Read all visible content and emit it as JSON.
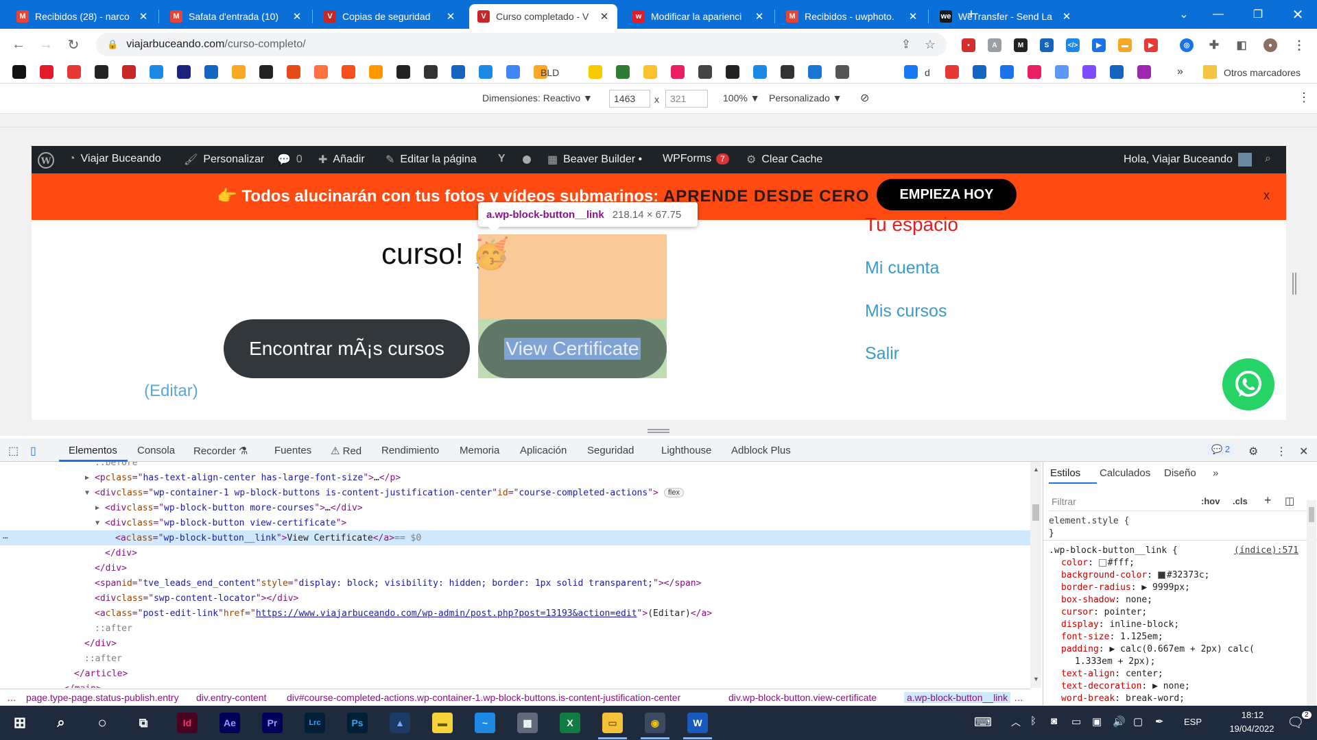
{
  "browser": {
    "tabs": [
      {
        "title": "Recibidos (28) - narco",
        "icon": "gmail-icon",
        "color": "#ea4335",
        "glyph": "M"
      },
      {
        "title": "Safata d'entrada (10)",
        "icon": "gmail-icon",
        "color": "#ea4335",
        "glyph": "M"
      },
      {
        "title": "Copias de seguridad",
        "icon": "site-icon",
        "color": "#c62828",
        "glyph": "V"
      },
      {
        "title": "Curso completado - V",
        "icon": "site-icon",
        "color": "#c62828",
        "glyph": "V"
      },
      {
        "title": "Modificar la aparienci",
        "icon": "wix-icon",
        "color": "#e21c2a",
        "glyph": "w"
      },
      {
        "title": "Recibidos - uwphoto.",
        "icon": "gmail-icon",
        "color": "#ea4335",
        "glyph": "M"
      },
      {
        "title": "WeTransfer - Send La",
        "icon": "wetransfer-icon",
        "color": "#17181a",
        "glyph": "we"
      }
    ],
    "active_tab": 3,
    "url_host": "viajarbuceando.com",
    "url_path": "/curso-completo/",
    "bookmarks_more": "»",
    "other_bookmarks": "Otros marcadores",
    "bookmark_bld": "BLD",
    "bookmark_d": "d"
  },
  "device_toolbar": {
    "dimensions_label": "Dimensiones: Reactivo ▼",
    "width": "1463",
    "times": "x",
    "height": "321",
    "zoom": "100% ▼",
    "throttle": "Personalizado ▼"
  },
  "adminbar": {
    "site": "Viajar Buceando",
    "customize": "Personalizar",
    "comments": "0",
    "add": "Añadir",
    "edit_page": "Editar la página",
    "beaver": "Beaver Builder •",
    "wpforms": "WPForms",
    "wpforms_count": "7",
    "clear_cache": "Clear Cache",
    "greeting": "Hola, Viajar Buceando"
  },
  "promo": {
    "text": "👉 Todos alucinarán con tus fotos y vídeos submarinos: ",
    "highlight": "APRENDE DESDE CERO",
    "button": "EMPIEZA HOY",
    "close": "x"
  },
  "content": {
    "heading": "curso! 🥳",
    "more_courses": "Encontrar mÃ¡s cursos",
    "view_certificate": "View Certificate",
    "edit": "(Editar)"
  },
  "inspector_tooltip": {
    "selector": "a.wp-block-button__link",
    "dims": "218.14 × 67.75"
  },
  "sidebar": {
    "title": "Tu espacio",
    "links": [
      "Mi cuenta",
      "Mis cursos",
      "Salir"
    ]
  },
  "devtools": {
    "tabs": [
      "Elementos",
      "Consola",
      "Recorder ⚗",
      "Fuentes",
      "⚠ Red",
      "Rendimiento",
      "Memoria",
      "Aplicación",
      "Seguridad",
      "Lighthouse",
      "Adblock Plus"
    ],
    "issues_count": "2",
    "elements": [
      {
        "indent": 0,
        "tri": "",
        "parts": [
          [
            "cm",
            "::before"
          ]
        ]
      },
      {
        "indent": 0,
        "tri": "▶",
        "parts": [
          [
            "tg",
            "<p "
          ],
          [
            "an",
            "class"
          ],
          [
            "tg",
            "=\""
          ],
          [
            "av",
            "has-text-align-center has-large-font-size"
          ],
          [
            "tg",
            "\">"
          ],
          [
            "",
            "…"
          ],
          [
            "tg",
            "</p>"
          ]
        ]
      },
      {
        "indent": 0,
        "tri": "▼",
        "parts": [
          [
            "tg",
            "<div "
          ],
          [
            "an",
            "class"
          ],
          [
            "tg",
            "=\""
          ],
          [
            "av",
            "wp-container-1 wp-block-buttons is-content-justification-center"
          ],
          [
            "tg",
            "\" "
          ],
          [
            "an",
            "id"
          ],
          [
            "tg",
            "=\""
          ],
          [
            "av",
            "course-completed-actions"
          ],
          [
            "tg",
            "\">"
          ]
        ],
        "badge": "flex"
      },
      {
        "indent": 1,
        "tri": "▶",
        "parts": [
          [
            "tg",
            "<div "
          ],
          [
            "an",
            "class"
          ],
          [
            "tg",
            "=\""
          ],
          [
            "av",
            "wp-block-button more-courses"
          ],
          [
            "tg",
            "\">"
          ],
          [
            "",
            "…"
          ],
          [
            "tg",
            "</div>"
          ]
        ]
      },
      {
        "indent": 1,
        "tri": "▼",
        "parts": [
          [
            "tg",
            "<div "
          ],
          [
            "an",
            "class"
          ],
          [
            "tg",
            "=\""
          ],
          [
            "av",
            "wp-block-button view-certificate"
          ],
          [
            "tg",
            "\">"
          ]
        ]
      },
      {
        "indent": 2,
        "tri": "",
        "sel": true,
        "parts": [
          [
            "tg",
            "<a "
          ],
          [
            "an",
            "class"
          ],
          [
            "tg",
            "=\""
          ],
          [
            "av",
            "wp-block-button__link"
          ],
          [
            "tg",
            "\">"
          ],
          [
            "",
            "View Certificate"
          ],
          [
            "tg",
            "</a>"
          ],
          [
            "cm",
            " == $0"
          ]
        ]
      },
      {
        "indent": 1,
        "tri": "",
        "parts": [
          [
            "tg",
            "</div>"
          ]
        ]
      },
      {
        "indent": 0,
        "tri": "",
        "parts": [
          [
            "tg",
            "</div>"
          ]
        ]
      },
      {
        "indent": 0,
        "tri": "",
        "parts": [
          [
            "tg",
            "<span "
          ],
          [
            "an",
            "id"
          ],
          [
            "tg",
            "=\""
          ],
          [
            "av",
            "tve_leads_end_content"
          ],
          [
            "tg",
            "\" "
          ],
          [
            "an",
            "style"
          ],
          [
            "tg",
            "=\""
          ],
          [
            "av",
            "display: block; visibility: hidden; border: 1px solid transparent;"
          ],
          [
            "tg",
            "\"></span>"
          ]
        ]
      },
      {
        "indent": 0,
        "tri": "",
        "parts": [
          [
            "tg",
            "<div "
          ],
          [
            "an",
            "class"
          ],
          [
            "tg",
            "=\""
          ],
          [
            "av",
            "swp-content-locator"
          ],
          [
            "tg",
            "\"></div>"
          ]
        ]
      },
      {
        "indent": 0,
        "tri": "",
        "parts": [
          [
            "tg",
            "<a "
          ],
          [
            "an",
            "class"
          ],
          [
            "tg",
            "=\""
          ],
          [
            "av",
            "post-edit-link"
          ],
          [
            "tg",
            "\" "
          ],
          [
            "an",
            "href"
          ],
          [
            "tg",
            "=\""
          ],
          [
            "lk",
            "https://www.viajarbuceando.com/wp-admin/post.php?post=13193&action=edit"
          ],
          [
            "tg",
            "\">"
          ],
          [
            "",
            "(Editar)"
          ],
          [
            "tg",
            "</a>"
          ]
        ]
      },
      {
        "indent": 0,
        "tri": "",
        "parts": [
          [
            "cm",
            "::after"
          ]
        ]
      },
      {
        "indent": -1,
        "tri": "",
        "parts": [
          [
            "tg",
            "</div>"
          ]
        ]
      },
      {
        "indent": -1,
        "tri": "",
        "parts": [
          [
            "cm",
            "::after"
          ]
        ]
      },
      {
        "indent": -2,
        "tri": "",
        "parts": [
          [
            "tg",
            "</article>"
          ]
        ]
      },
      {
        "indent": -3,
        "tri": "",
        "parts": [
          [
            "tg",
            "</main>"
          ]
        ]
      }
    ],
    "breadcrumb": [
      "…",
      "page.type-page.status-publish.entry",
      "div.entry-content",
      "div#course-completed-actions.wp-container-1.wp-block-buttons.is-content-justification-center",
      "div.wp-block-button.view-certificate",
      "a.wp-block-button__link",
      "…"
    ],
    "styles": {
      "tabs": [
        "Estilos",
        "Calculados",
        "Diseño",
        "»"
      ],
      "filter_placeholder": "Filtrar",
      "hov": ":hov",
      "cls": ".cls",
      "element_style": "element.style {",
      "close_brace": "}",
      "rule_selector": ".wp-block-button__link {",
      "rule_source": "(índice):571",
      "props": [
        [
          "color",
          "#fff;",
          "#ffffff"
        ],
        [
          "background-color",
          "#32373c;",
          "#32373c"
        ],
        [
          "border-radius",
          "▶ 9999px;",
          ""
        ],
        [
          "box-shadow",
          "none;",
          ""
        ],
        [
          "cursor",
          "pointer;",
          ""
        ],
        [
          "display",
          "inline-block;",
          ""
        ],
        [
          "font-size",
          "1.125em;",
          ""
        ],
        [
          "padding",
          "▶ calc(0.667em + 2px) calc(",
          ""
        ],
        [
          "",
          "1.333em + 2px);",
          ""
        ],
        [
          "text-align",
          "center;",
          ""
        ],
        [
          "text-decoration",
          "▶ none;",
          ""
        ],
        [
          "word-break",
          "break-word;",
          ""
        ]
      ]
    }
  },
  "taskbar": {
    "apps": [
      {
        "icon": "indesign-icon",
        "glyph": "Id",
        "color": "#49021f",
        "fg": "#ff3366"
      },
      {
        "icon": "after-effects-icon",
        "glyph": "Ae",
        "color": "#00005b",
        "fg": "#9999ff"
      },
      {
        "icon": "premiere-icon",
        "glyph": "Pr",
        "color": "#00005b",
        "fg": "#9999ff"
      },
      {
        "icon": "lightroom-classic-icon",
        "glyph": "Lrc",
        "color": "#001e36",
        "fg": "#31a8ff"
      },
      {
        "icon": "photoshop-icon",
        "glyph": "Ps",
        "color": "#001e36",
        "fg": "#31a8ff"
      },
      {
        "icon": "affinity-icon",
        "glyph": "▲",
        "color": "#1b3a66",
        "fg": "#7aa7ff"
      },
      {
        "icon": "sticky-notes-icon",
        "glyph": "▬",
        "color": "#f5d33a",
        "fg": "#6b5900"
      },
      {
        "icon": "whiteboard-icon",
        "glyph": "~",
        "color": "#1e88e5",
        "fg": "#fff"
      },
      {
        "icon": "calculator-icon",
        "glyph": "▦",
        "color": "#5f6b7a",
        "fg": "#fff"
      },
      {
        "icon": "excel-icon",
        "glyph": "X",
        "color": "#107c41",
        "fg": "#fff"
      },
      {
        "icon": "explorer-icon",
        "glyph": "▭",
        "color": "#f3c13a",
        "fg": "#8a6a00"
      },
      {
        "icon": "chrome-icon",
        "glyph": "◉",
        "color": "#3a4a60",
        "fg": "#fbbc04"
      },
      {
        "icon": "word-icon",
        "glyph": "W",
        "color": "#185abd",
        "fg": "#fff"
      }
    ],
    "lang": "ESP",
    "time": "18:12",
    "date": "19/04/2022",
    "notif_count": "2"
  }
}
